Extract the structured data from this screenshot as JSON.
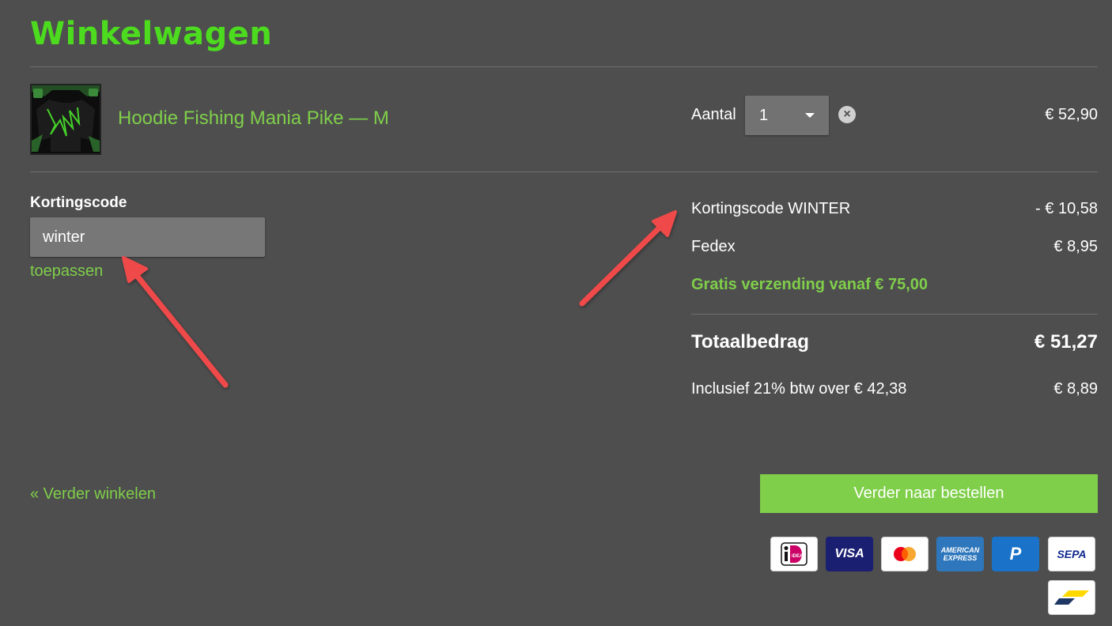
{
  "page": {
    "title": "Winkelwagen"
  },
  "cart": {
    "items": [
      {
        "name": "Hoodie Fishing Mania Pike — M",
        "quantity_label": "Aantal",
        "quantity": "1",
        "price": "€ 52,90"
      }
    ]
  },
  "coupon": {
    "label": "Kortingscode",
    "value": "winter",
    "apply_label": "toepassen"
  },
  "summary": {
    "discount_label": "Kortingscode WINTER",
    "discount_value": "- € 10,58",
    "shipping_label": "Fedex",
    "shipping_value": "€ 8,95",
    "free_shipping_note": "Gratis verzending vanaf € 75,00",
    "total_label": "Totaalbedrag",
    "total_value": "€ 51,27",
    "vat_label": "Inclusief 21% btw over € 42,38",
    "vat_value": "€ 8,89"
  },
  "actions": {
    "continue_shopping": "« Verder winkelen",
    "checkout": "Verder naar bestellen"
  },
  "payment_methods": [
    {
      "name": "ideal-icon",
      "text": "iDEAL"
    },
    {
      "name": "visa-icon",
      "text": "VISA"
    },
    {
      "name": "mastercard-icon"
    },
    {
      "name": "american-express-icon",
      "text_top": "AMERICAN",
      "text_bottom": "EXPRESS"
    },
    {
      "name": "paypal-icon",
      "text": "P"
    },
    {
      "name": "sepa-icon",
      "text": "SEPA"
    },
    {
      "name": "bancontact-icon"
    }
  ],
  "colors": {
    "background": "#4e4e4e",
    "accent": "#7fcf4a",
    "title": "#4cdb1e",
    "annotation_arrow": "#f04a4a"
  }
}
